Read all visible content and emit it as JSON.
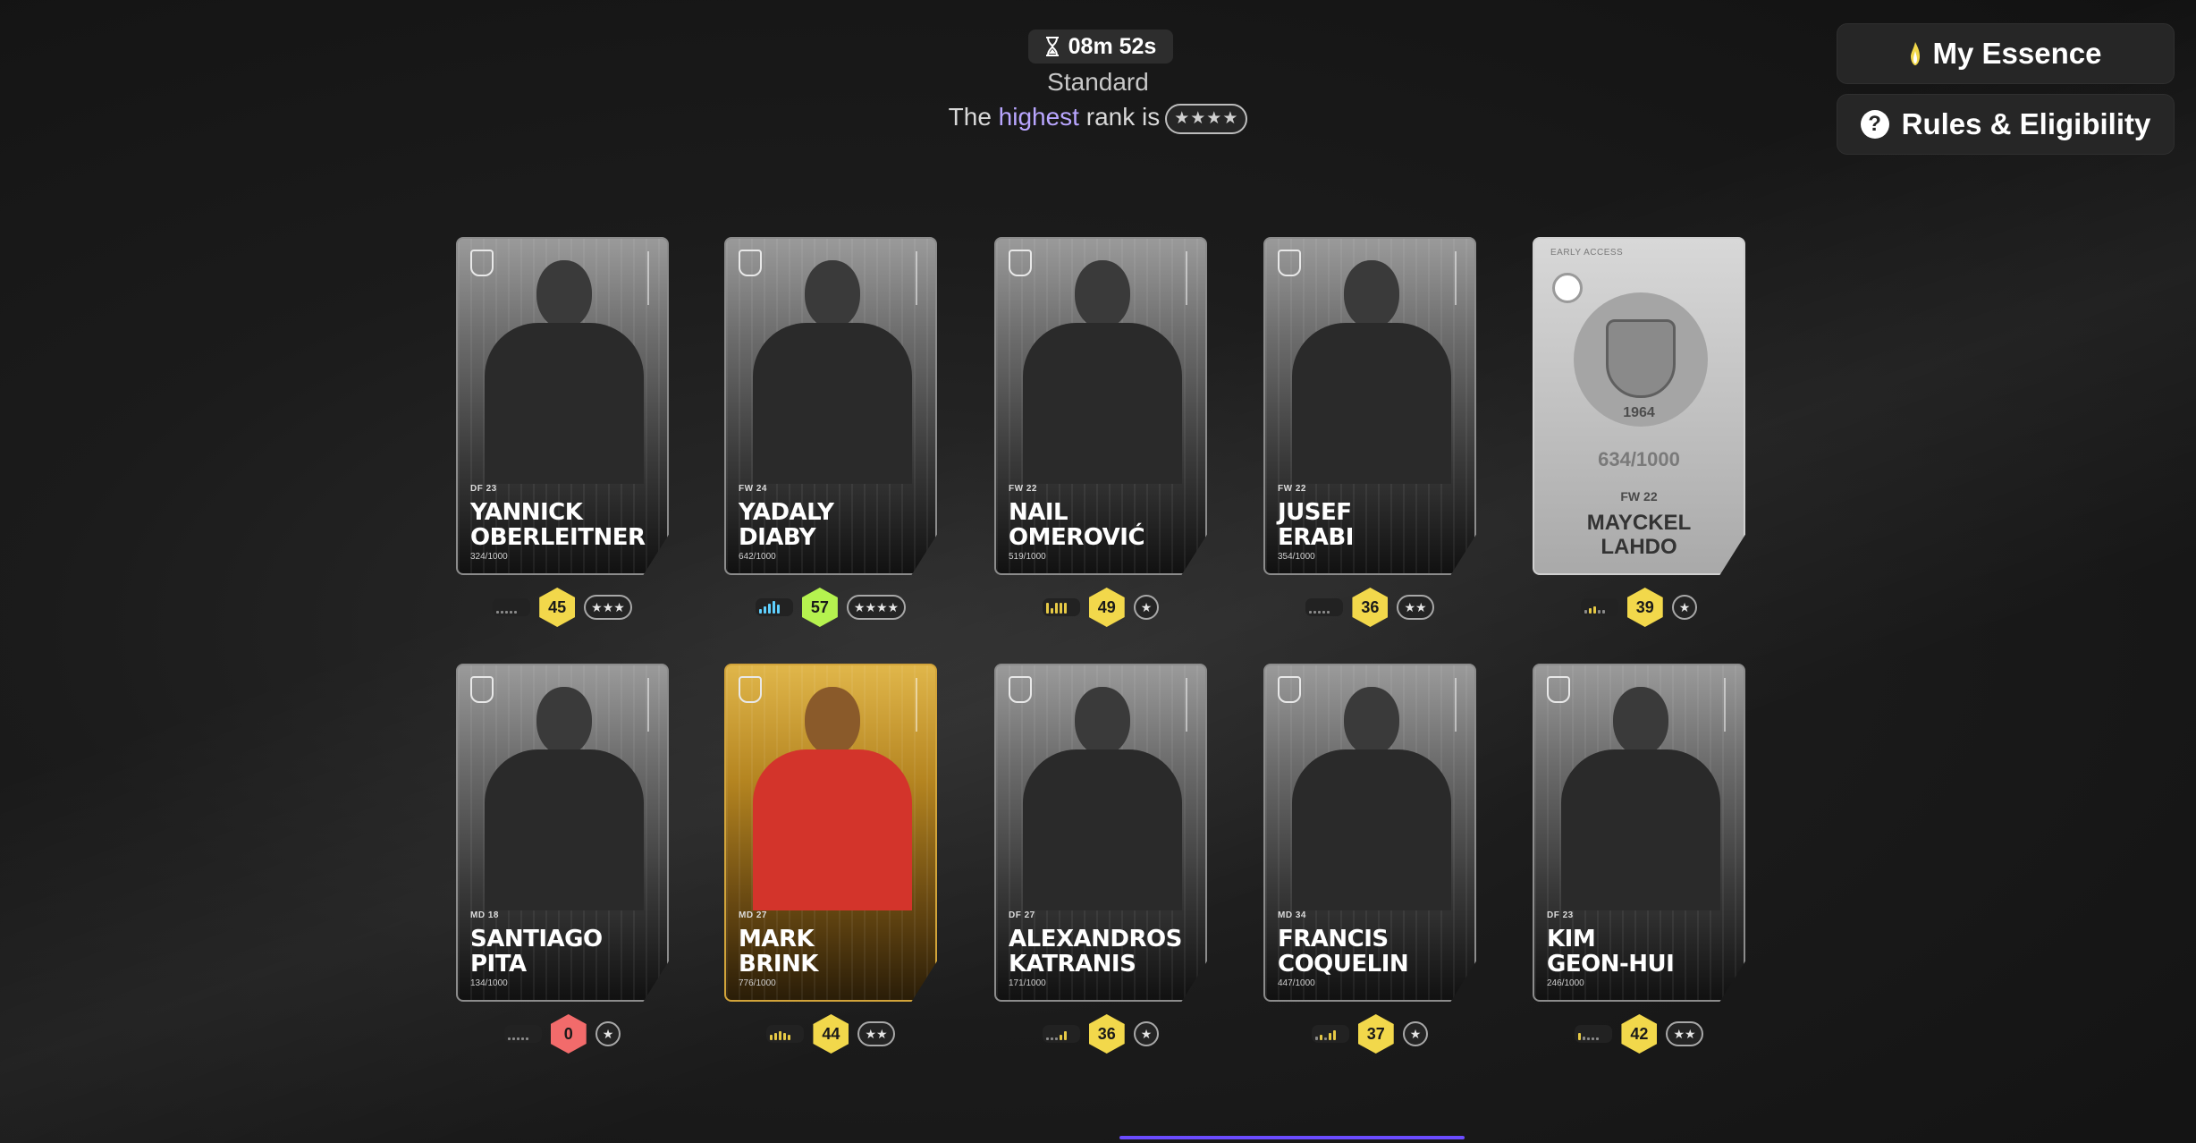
{
  "header": {
    "timer": "08m 52s",
    "mode": "Standard",
    "rank_text_before": "The ",
    "rank_highlight": "highest",
    "rank_text_after": " rank is",
    "rank_stars": "★★★★"
  },
  "sidebar": {
    "essence_label": "My Essence",
    "rules_label": "Rules & Eligibility"
  },
  "cards": [
    {
      "first": "YANNICK",
      "last": "OBERLEITNER",
      "pos": "DF",
      "age": "23",
      "serial": "324/1000",
      "score": "45",
      "stars": "★★★",
      "tier": "yellow",
      "type": "silver",
      "bars": [
        3,
        3,
        3,
        3,
        3
      ]
    },
    {
      "first": "YADALY",
      "last": "DIABY",
      "pos": "FW",
      "age": "24",
      "serial": "642/1000",
      "score": "57",
      "stars": "★★★★",
      "tier": "green",
      "type": "silver",
      "bars": [
        5,
        8,
        11,
        14,
        10
      ]
    },
    {
      "first": "NAIL",
      "last": "OMEROVIĆ",
      "pos": "FW",
      "age": "22",
      "serial": "519/1000",
      "score": "49",
      "stars": "★",
      "tier": "yellow",
      "type": "silver",
      "bars": [
        12,
        6,
        12,
        12,
        12
      ]
    },
    {
      "first": "JUSEF",
      "last": "ERABI",
      "pos": "FW",
      "age": "22",
      "serial": "354/1000",
      "score": "36",
      "stars": "★★",
      "tier": "yellow",
      "type": "silver",
      "bars": [
        3,
        3,
        3,
        3,
        3
      ]
    },
    {
      "first": "MAYCKEL",
      "last": "LAHDO",
      "pos": "FW",
      "age": "22",
      "serial": "634/1000",
      "score": "39",
      "stars": "★",
      "tier": "yellow",
      "type": "limited",
      "early_access": "EARLY ACCESS",
      "year": "1964",
      "bars": [
        4,
        6,
        8,
        4,
        4
      ]
    },
    {
      "first": "SANTIAGO",
      "last": "PITA",
      "pos": "MD",
      "age": "18",
      "serial": "134/1000",
      "score": "0",
      "stars": "★",
      "tier": "red",
      "type": "silver",
      "bars": [
        3,
        3,
        3,
        3,
        3
      ]
    },
    {
      "first": "MARK",
      "last": "BRINK",
      "pos": "MD",
      "age": "27",
      "serial": "776/1000",
      "score": "44",
      "stars": "★★",
      "tier": "yellow",
      "type": "gold",
      "bars": [
        6,
        8,
        10,
        8,
        6
      ]
    },
    {
      "first": "ALEXANDROS",
      "last": "KATRANIS",
      "pos": "DF",
      "age": "27",
      "serial": "171/1000",
      "score": "36",
      "stars": "★",
      "tier": "yellow",
      "type": "silver",
      "bars": [
        3,
        3,
        3,
        6,
        10
      ]
    },
    {
      "first": "FRANCIS",
      "last": "COQUELIN",
      "pos": "MD",
      "age": "34",
      "serial": "447/1000",
      "score": "37",
      "stars": "★",
      "tier": "yellow",
      "type": "silver",
      "bars": [
        4,
        6,
        3,
        8,
        11
      ]
    },
    {
      "first": "KIM",
      "last": "GEON-HUI",
      "pos": "DF",
      "age": "23",
      "serial": "246/1000",
      "score": "42",
      "stars": "★★",
      "tier": "yellow",
      "type": "silver",
      "bars": [
        8,
        4,
        3,
        3,
        3
      ]
    }
  ]
}
